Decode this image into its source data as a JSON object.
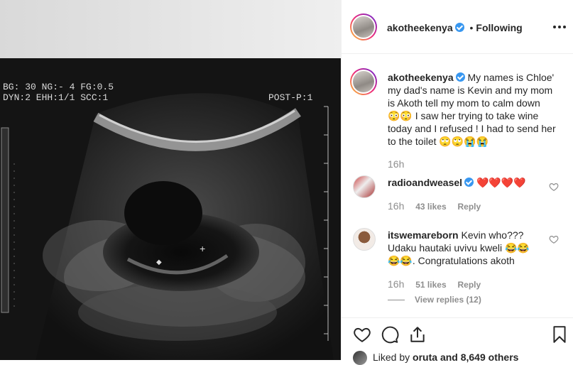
{
  "ultrasound": {
    "line1": "BG: 30 NG:- 4 FG:0.5",
    "line2": "DYN:2 EHH:1/1 SCC:1",
    "tag": "POST-P:1"
  },
  "post": {
    "author": "akotheekenya",
    "follow_separator": "•",
    "follow_label": "Following",
    "more_icon": "more-dots-icon",
    "caption_lines": [
      "My names is Chloe'",
      "my dad's name is Kevin and my mom",
      "is Akoth tell my mom to calm down",
      "😳😳 I saw her trying to take wine",
      "today and I refused ! I had to send her",
      "to the toilet 🙄🙄😭😭"
    ],
    "caption_time": "16h"
  },
  "comments": [
    {
      "user": "radioandweasel",
      "text": "❤️❤️❤️❤️",
      "time": "16h",
      "likes": "43 likes",
      "reply": "Reply"
    },
    {
      "user": "itswemareborn",
      "lines": [
        "Kevin who???",
        "Udaku hautaki uvivu kweli 😂😂",
        "😂😂. Congratulations akoth"
      ],
      "time": "16h",
      "likes": "51 likes",
      "reply": "Reply",
      "view_replies": "View replies (12)"
    }
  ],
  "actions": {
    "like_icon": "heart-icon",
    "comment_icon": "comment-icon",
    "share_icon": "share-icon",
    "save_icon": "bookmark-icon"
  },
  "liked_by": {
    "prefix": "Liked by",
    "user": "oruta",
    "suffix": "and 8,649 others"
  }
}
